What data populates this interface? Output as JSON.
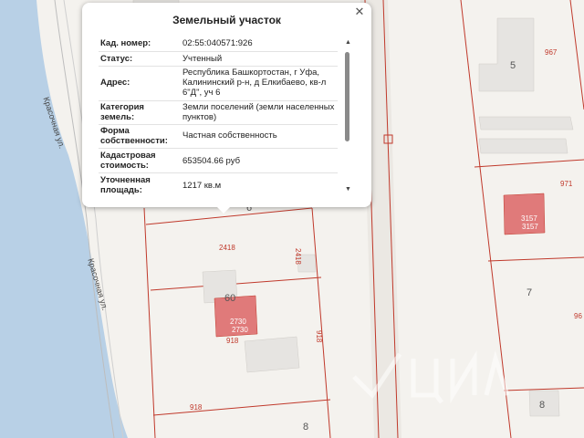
{
  "popup": {
    "title": "Земельный участок",
    "close_icon": "close-icon",
    "rows": [
      {
        "label": "Кад. номер:",
        "value": "02:55:040571:926"
      },
      {
        "label": "Статус:",
        "value": "Учтенный"
      },
      {
        "label": "Адрес:",
        "value": "Республика Башкортостан, г Уфа, Калининский р-н, д Елкибаево, кв-л 6\"Д\", уч 6"
      },
      {
        "label": "Категория земель:",
        "value": "Земли поселений (земли населенных пунктов)"
      },
      {
        "label": "Форма собственности:",
        "value": "Частная собственность"
      },
      {
        "label": "Кадастровая стоимость:",
        "value": "653504.66 руб"
      },
      {
        "label": "Уточненная площадь:",
        "value": "1217 кв.м"
      }
    ],
    "scroll_up_icon": "triangle-up-icon",
    "scroll_down_icon": "triangle-down-icon"
  },
  "map": {
    "streets": [
      "Красочная ул.",
      "Красочная ул."
    ],
    "parcel_numbers": [
      "2418",
      "2418",
      "918",
      "918",
      "918",
      "967",
      "971",
      "96"
    ],
    "house_numbers": [
      "5",
      "6",
      "60",
      "7",
      "8",
      "8"
    ],
    "building_labels": [
      "2730",
      "2730",
      "3157",
      "3157"
    ],
    "watermark_icon": "cian-watermark-icon",
    "colors": {
      "water": "#b8d0e6",
      "land": "#f4f2ee",
      "parcel_border": "#c0392b",
      "building_highlight": "#e07a7a",
      "building_gray": "#e6e4e1"
    }
  }
}
